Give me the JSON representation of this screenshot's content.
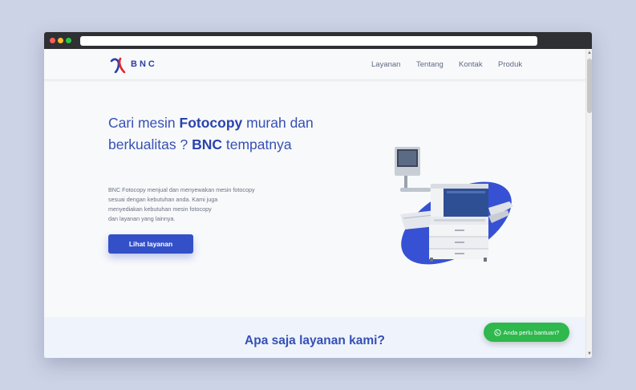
{
  "nav": {
    "brand": "BNC",
    "items": [
      "Layanan",
      "Tentang",
      "Kontak",
      "Produk"
    ]
  },
  "hero": {
    "title_part1": "Cari mesin ",
    "title_highlight1": "Fotocopy",
    "title_part2": " murah dan berkualitas ? ",
    "title_highlight2": "BNC",
    "title_part3": " tempatnya",
    "description_lines": [
      "BNC Fotocopy menjual dan menyewakan mesin fotocopy",
      "sesuai dengan kebutuhan anda. Kami juga",
      "menyediakan kebutuhan mesin fotocopy",
      "dan layanan yang lainnya."
    ],
    "cta_label": "Lihat layanan"
  },
  "services": {
    "title": "Apa saja layanan kami?"
  },
  "whatsapp": {
    "label": "Anda perlu bantuan?"
  },
  "icons": {
    "logo": "bnc-logo-icon",
    "whatsapp": "whatsapp-icon",
    "copier": "photocopier-illustration"
  },
  "colors": {
    "primary": "#3450c9",
    "brand_red": "#e0262e",
    "whatsapp_green": "#2eb84d",
    "background": "#f8f9fb"
  }
}
